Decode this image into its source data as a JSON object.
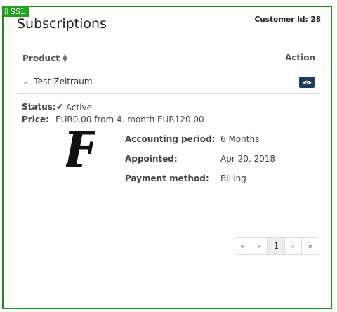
{
  "ssl_badge": {
    "label": "SSL",
    "icon": "lock-icon"
  },
  "header": {
    "title": "Subscriptions",
    "customer_id": "Customer Id: 28"
  },
  "table": {
    "columns": {
      "product": "Product",
      "action": "Action"
    },
    "rows": [
      {
        "name": "Test-Zeitraum",
        "expanded": true,
        "action_icon": "eye-icon"
      }
    ]
  },
  "details": {
    "status_label": "Status:",
    "status_value": "Active",
    "price_label": "Price:",
    "price_value": "EUR0.00 from 4. month EUR120.00",
    "fields": [
      {
        "label": "Accounting period:",
        "value": "6 Months"
      },
      {
        "label": "Appointed:",
        "value": "Apr 20, 2018"
      },
      {
        "label": "Payment method:",
        "value": "Billing"
      }
    ],
    "logo_letter": "F"
  },
  "pagination": {
    "first": "«",
    "prev": "‹",
    "current": "1",
    "next": "›",
    "last": "»"
  },
  "colors": {
    "frame": "#1f8a1f",
    "ssl_badge": "#22a322",
    "view_button": "#1d3b5c"
  }
}
